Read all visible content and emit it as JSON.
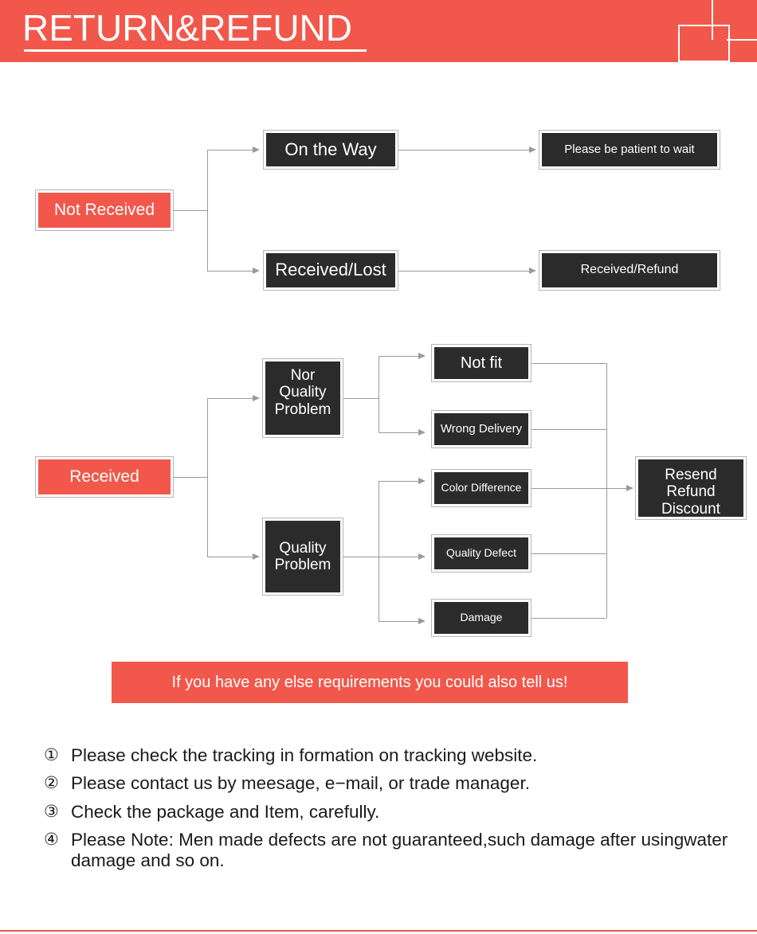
{
  "header": {
    "title": "RETURN&REFUND",
    "accent_color": "#F1584B"
  },
  "colors": {
    "accent": "#F1584B",
    "dark_node": "#2b2b2b",
    "node_border": "#b6b6b6",
    "connector": "#9a9a9a",
    "text_dark": "#1a1a1a"
  },
  "flow_not_received": {
    "root": {
      "label": "Not Received",
      "style": "red"
    },
    "branches": [
      {
        "label": "On the Way",
        "style": "dark",
        "result": {
          "label": "Please be patient to wait",
          "style": "dark"
        }
      },
      {
        "label": "Received/Lost",
        "style": "dark",
        "result": {
          "label": "Received/Refund",
          "style": "dark"
        }
      }
    ]
  },
  "flow_received": {
    "root": {
      "label": "Received",
      "style": "red"
    },
    "branches": [
      {
        "label": "Nor\nQuality\nProblem",
        "label_lines": [
          "Nor",
          "Quality",
          "Problem"
        ],
        "style": "dark",
        "reasons": [
          {
            "label": "Not fit",
            "style": "dark"
          },
          {
            "label": "Wrong Delivery",
            "style": "dark"
          }
        ]
      },
      {
        "label": "Quality\nProblem",
        "label_lines": [
          "Quality",
          "Problem"
        ],
        "style": "dark",
        "reasons": [
          {
            "label": "Color Difference",
            "style": "dark"
          },
          {
            "label": "Quality Defect",
            "style": "dark"
          },
          {
            "label": "Damage",
            "style": "dark"
          }
        ]
      }
    ],
    "outcome": {
      "label": "Resend\nRefund\nDiscount",
      "label_lines": [
        "Resend",
        "Refund",
        "Discount"
      ],
      "style": "dark"
    }
  },
  "notice": {
    "text": "If you have any else requirements you could also tell us!"
  },
  "notes": [
    {
      "num": "①",
      "text": "Please check the tracking in formation on tracking website."
    },
    {
      "num": "②",
      "text": "Please contact us by meesage, e−mail, or trade manager."
    },
    {
      "num": "③",
      "text": "Check the package and Item, carefully."
    },
    {
      "num": "④",
      "text": "Please Note: Men made defects are not guaranteed,such damage after usingwater damage and so on."
    }
  ]
}
